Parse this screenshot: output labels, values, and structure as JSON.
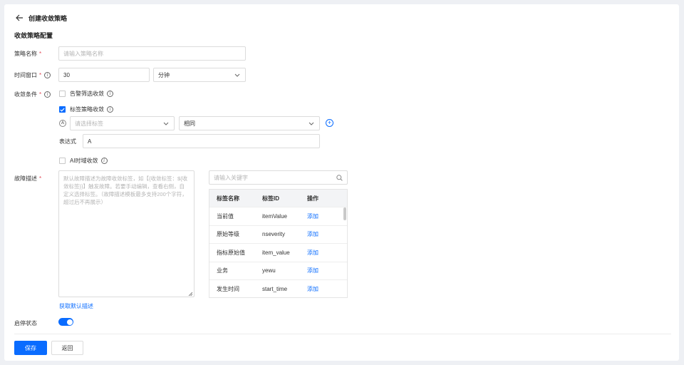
{
  "header": {
    "title": "创建收敛策略"
  },
  "section": {
    "title": "收敛策略配置"
  },
  "form": {
    "name": {
      "label": "策略名称",
      "required_mark": "*",
      "placeholder": "请输入策略名称"
    },
    "window": {
      "label": "时间窗口",
      "required_mark": "*",
      "value": "30",
      "unit": "分钟"
    },
    "condition": {
      "label": "收敛条件",
      "required_mark": "*",
      "alert_filter": {
        "label": "告警筛选收敛",
        "checked": false
      },
      "tag_policy": {
        "label": "标签策略收敛",
        "checked": true
      },
      "rule": {
        "badge": "A",
        "tag_placeholder": "请选择标签",
        "operator": "相同"
      },
      "expression": {
        "label": "表达式",
        "value": "A"
      },
      "ai_window": {
        "label": "AI时域收敛",
        "checked": false
      }
    },
    "fault": {
      "label": "故障描述",
      "required_mark": "*",
      "placeholder": "默认故障描述为故障收敛标签，如【{收敛标签：${收敛标签}}】触发故障。若要手动编辑，查看右侧，自定义选择标签。（故障描述模板最多支持200个字符，超过后不再展示）",
      "default_link": "获取默认描述",
      "search_placeholder": "请输入关键字",
      "table": {
        "headers": [
          "标签名称",
          "标签ID",
          "操作"
        ],
        "rows": [
          {
            "name": "当前值",
            "id": "itemValue",
            "action": "添加"
          },
          {
            "name": "原始等级",
            "id": "nseverity",
            "action": "添加"
          },
          {
            "name": "指标原始值",
            "id": "item_value",
            "action": "添加"
          },
          {
            "name": "业务",
            "id": "yewu",
            "action": "添加"
          },
          {
            "name": "发生时间",
            "id": "start_time",
            "action": "添加"
          }
        ]
      }
    },
    "status": {
      "label": "启停状态",
      "enabled": true
    }
  },
  "footer": {
    "save_label": "保存",
    "back_label": "返回"
  },
  "colors": {
    "primary": "#0a6cff",
    "required": "#e34d59"
  }
}
